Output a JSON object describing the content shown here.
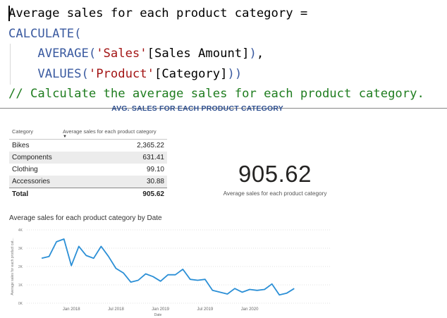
{
  "editor": {
    "lines": [
      [
        {
          "t": "Average sales for each product category =",
          "c": "plain"
        }
      ],
      [
        {
          "t": "CALCULATE",
          "c": "fn"
        },
        {
          "t": "(",
          "c": "paren"
        }
      ],
      [
        {
          "t": "    AVERAGE",
          "c": "fn"
        },
        {
          "t": "(",
          "c": "paren"
        },
        {
          "t": "'Sales'",
          "c": "str"
        },
        {
          "t": "[Sales Amount]",
          "c": "plain"
        },
        {
          "t": ")",
          "c": "paren"
        },
        {
          "t": ",",
          "c": "plain"
        }
      ],
      [
        {
          "t": "    VALUES",
          "c": "fn"
        },
        {
          "t": "(",
          "c": "paren"
        },
        {
          "t": "'Product'",
          "c": "str"
        },
        {
          "t": "[Category]",
          "c": "plain"
        },
        {
          "t": "))",
          "c": "paren"
        }
      ],
      [
        {
          "t": "// Calculate the average sales for each product category.",
          "c": "comment"
        }
      ]
    ]
  },
  "report": {
    "title": "AVG. SALES FOR EACH PRODUCT CATEGORY"
  },
  "table": {
    "columns": [
      "Category",
      "Average sales for each product category"
    ],
    "rows": [
      {
        "category": "Bikes",
        "value": "2,365.22"
      },
      {
        "category": "Components",
        "value": "631.41"
      },
      {
        "category": "Clothing",
        "value": "99.10"
      },
      {
        "category": "Accessories",
        "value": "30.88"
      }
    ],
    "total_label": "Total",
    "total_value": "905.62"
  },
  "kpi": {
    "value": "905.62",
    "label": "Average sales for each product category"
  },
  "chart_data": {
    "type": "line",
    "title": "Average sales for each product category by Date",
    "xlabel": "Date",
    "ylabel": "Average sales for each product cat...",
    "x_tick_labels": [
      "Jan 2018",
      "Jul 2018",
      "Jan 2019",
      "Jul 2019",
      "Jan 2020"
    ],
    "y_tick_labels": [
      "0K",
      "1K",
      "2K",
      "3K",
      "4K"
    ],
    "ylim": [
      0,
      4000
    ],
    "x_index_range": [
      0,
      41
    ],
    "x_tick_positions": [
      6,
      12,
      18,
      24,
      30
    ],
    "grid": true,
    "line_color": "#2b8fd6",
    "series": [
      {
        "values": [
          2450,
          2550,
          3350,
          3500,
          2050,
          3100,
          2600,
          2450,
          3100,
          2550,
          1900,
          1650,
          1150,
          1250,
          1600,
          1450,
          1200,
          1550,
          1550,
          1850,
          1300,
          1250,
          1300,
          700,
          600,
          500,
          800,
          600,
          750,
          700,
          750,
          1050,
          450,
          550,
          800
        ]
      }
    ]
  }
}
